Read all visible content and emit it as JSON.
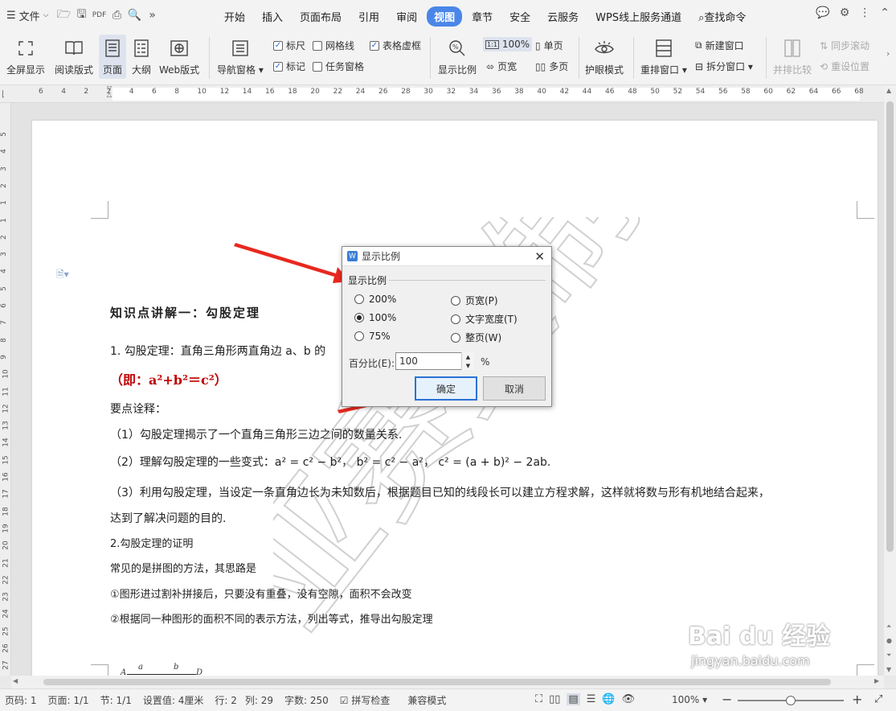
{
  "topbar": {
    "file_label": "文件",
    "tabs": [
      "开始",
      "插入",
      "页面布局",
      "引用",
      "审阅",
      "视图",
      "章节",
      "安全",
      "云服务",
      "WPS线上服务通道"
    ],
    "active_tab": "视图",
    "search_label": "查找命令"
  },
  "ribbon": {
    "fullscreen": "全屏显示",
    "reading": "阅读版式",
    "page": "页面",
    "outline": "大纲",
    "web": "Web版式",
    "nav_pane": "导航窗格",
    "ruler": "标尺",
    "gridlines": "网格线",
    "table_gridlines": "表格虚框",
    "marks": "标记",
    "task_pane": "任务窗格",
    "zoom": "显示比例",
    "zoom100": "100%",
    "one_page": "单页",
    "page_width": "页宽",
    "multi_page": "多页",
    "eye_mode": "护眼模式",
    "arrange": "重排窗口",
    "new_window": "新建窗口",
    "split_window": "拆分窗口",
    "side_by_side": "并排比较",
    "sync_scroll": "同步滚动",
    "reset_pos": "重设位置"
  },
  "ruler": {
    "h_ticks": [
      "6",
      "4",
      "2",
      "2",
      "4",
      "6",
      "8",
      "10",
      "12",
      "14",
      "16",
      "18",
      "20",
      "22",
      "24",
      "26",
      "28",
      "30",
      "32",
      "34",
      "36",
      "38",
      "40",
      "42",
      "44",
      "46",
      "48",
      "50",
      "52",
      "54",
      "56",
      "58",
      "60",
      "62",
      "64",
      "66",
      "68"
    ],
    "v_ticks": [
      "5",
      "4",
      "3",
      "2",
      "1",
      "1",
      "2",
      "3",
      "4",
      "5",
      "6",
      "7",
      "8",
      "9",
      "10",
      "11",
      "12",
      "13",
      "14",
      "15",
      "16",
      "17",
      "18",
      "19",
      "20",
      "21",
      "22",
      "23",
      "24",
      "25",
      "26",
      "27"
    ]
  },
  "document": {
    "heading": "知识点讲解一：勾股定理",
    "line1": "1. 勾股定理：直角三角形两直角边 a、b 的",
    "formula": "（即：a²+b²＝c²）",
    "note_title": "要点诠释：",
    "p1": "（1）勾股定理揭示了一个直角三角形三边之间的数量关系.",
    "p2": "（2）理解勾股定理的一些变式：a² = c² − b²，  b² = c² − a²，   c² = (a + b)² − 2ab.",
    "p3": "（3）利用勾股定理，当设定一条直角边长为未知数后，根据题目已知的线段长可以建立方程求解，这样就将数与形有机地结合起来，",
    "p3b": "达到了解决问题的目的.",
    "s2": "2.勾股定理的证明",
    "s2a": "常见的是拼图的方法，其思路是",
    "s2b": "①图形进过割补拼接后，只要没有重叠，没有空隙，面积不会改变",
    "s2c": "②根据同一种图形的面积不同的表示方法，列出等式，推导出勾股定理",
    "watermark": "亚赛复制",
    "fig_labels": [
      "A",
      "a",
      "b",
      "D"
    ]
  },
  "dialog": {
    "title": "显示比例",
    "group": "显示比例",
    "options_left": [
      "200%",
      "100%",
      "75%"
    ],
    "options_right": [
      "页宽(P)",
      "文字宽度(T)",
      "整页(W)"
    ],
    "selected": "100%",
    "percent_label": "百分比(E):",
    "percent_value": "100",
    "percent_unit": "%",
    "ok": "确定",
    "cancel": "取消"
  },
  "status": {
    "page_no": "页码: 1",
    "pages": "页面: 1/1",
    "section": "节: 1/1",
    "setting": "设置值: 4厘米",
    "row": "行: 2",
    "col": "列: 29",
    "words": "字数: 250",
    "spell": "拼写检查",
    "compat": "兼容模式",
    "zoom": "100%",
    "zoom_level": 0.5
  },
  "branding": {
    "baidu": "Bai du 经验",
    "url": "jingyan.baidu.com"
  },
  "colors": {
    "accent": "#4a86e8",
    "arrow": "#e8281e",
    "formula": "#c00000"
  }
}
